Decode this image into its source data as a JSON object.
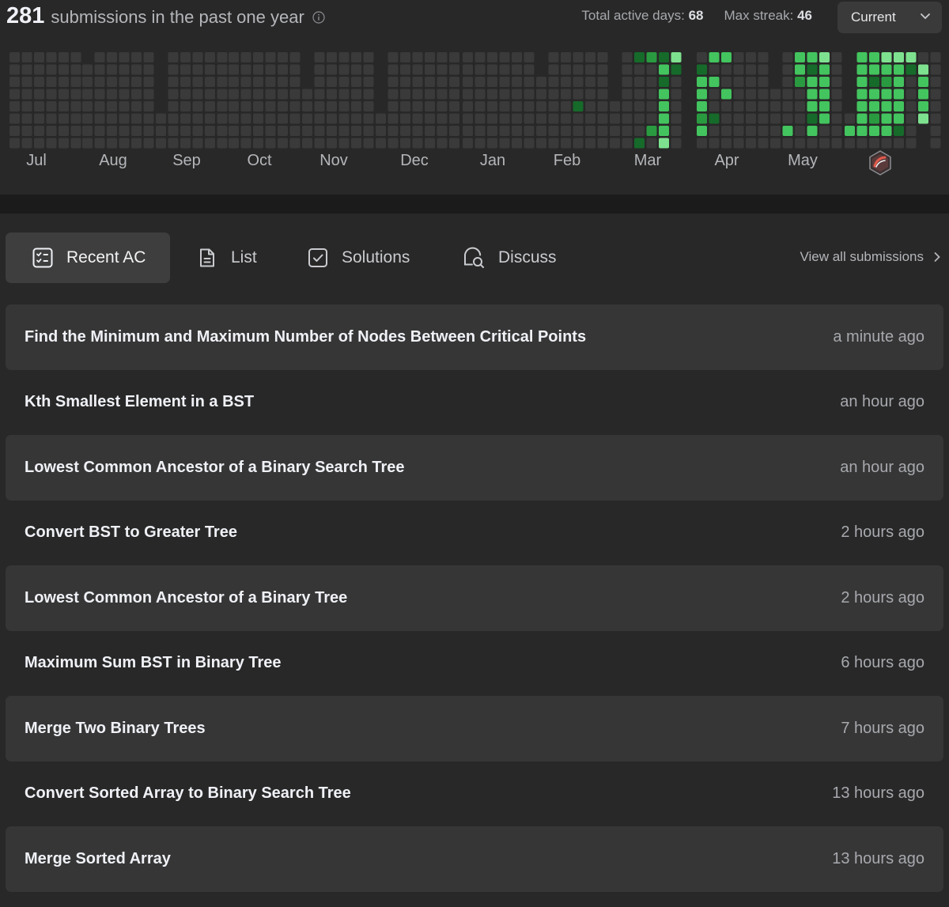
{
  "summary": {
    "count": "281",
    "text": "submissions in the past one year",
    "info_icon": "info-circle-icon"
  },
  "stats": {
    "active_days_label": "Total active days:",
    "active_days_value": "68",
    "max_streak_label": "Max streak:",
    "max_streak_value": "46"
  },
  "range_select": {
    "value": "Current",
    "icon": "chevron-down-icon"
  },
  "calendar": {
    "months": [
      "Jul",
      "Aug",
      "Sep",
      "Oct",
      "Nov",
      "Dec",
      "Jan",
      "Feb",
      "Mar",
      "Apr",
      "May"
    ],
    "badge_icon": "contest-badge-icon",
    "colors": {
      "empty": "#3a3a3a",
      "level1": "#166a2a",
      "level2": "#2a9a40",
      "level3": "#43c45e",
      "level4": "#7ee18f"
    }
  },
  "tabs": [
    {
      "label": "Recent AC",
      "icon": "recent-ac-icon",
      "active": true
    },
    {
      "label": "List",
      "icon": "document-icon",
      "active": false
    },
    {
      "label": "Solutions",
      "icon": "checkbox-icon",
      "active": false
    },
    {
      "label": "Discuss",
      "icon": "discuss-icon",
      "active": false
    }
  ],
  "view_all": {
    "label": "View all submissions",
    "icon": "chevron-right-icon"
  },
  "submissions": [
    {
      "title": "Find the Minimum and Maximum Number of Nodes Between Critical Points",
      "time": "a minute ago"
    },
    {
      "title": "Kth Smallest Element in a BST",
      "time": "an hour ago"
    },
    {
      "title": "Lowest Common Ancestor of a Binary Search Tree",
      "time": "an hour ago"
    },
    {
      "title": "Convert BST to Greater Tree",
      "time": "2 hours ago"
    },
    {
      "title": "Lowest Common Ancestor of a Binary Tree",
      "time": "2 hours ago"
    },
    {
      "title": "Maximum Sum BST in Binary Tree",
      "time": "6 hours ago"
    },
    {
      "title": "Merge Two Binary Trees",
      "time": "7 hours ago"
    },
    {
      "title": "Convert Sorted Array to Binary Search Tree",
      "time": "13 hours ago"
    },
    {
      "title": "Merge Sorted Array",
      "time": "13 hours ago"
    }
  ]
}
